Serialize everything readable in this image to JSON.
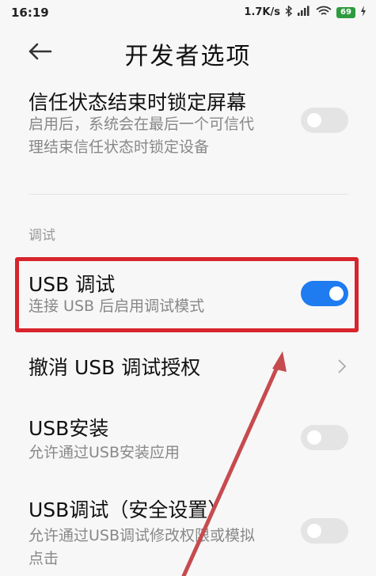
{
  "status_bar": {
    "time": "16:19",
    "speed": "1.7K/s",
    "battery": "69"
  },
  "header": {
    "title": "开发者选项"
  },
  "settings": {
    "trust_lock": {
      "title": "信任状态结束时锁定屏幕",
      "desc_line1": "启用后，系统会在最后一个可信代",
      "desc_line2": "理结束信任状态时锁定设备",
      "enabled": false
    },
    "section_label": "调试",
    "usb_debug": {
      "title": "USB 调试",
      "desc": "连接 USB 后启用调试模式",
      "enabled": true
    },
    "revoke_usb": {
      "title": "撤消 USB 调试授权"
    },
    "usb_install": {
      "title": "USB安装",
      "desc": "允许通过USB安装应用",
      "enabled": false
    },
    "usb_debug_secure": {
      "title": "USB调试（安全设置）",
      "desc_line1": "允许通过USB调试修改权限或模拟",
      "desc_line2": "点击",
      "enabled": false
    }
  },
  "colors": {
    "toggle_on": "#1e7bf0",
    "toggle_off": "#e4e4e4",
    "highlight": "#d8242c",
    "annotation_arrow": "#c64b4f"
  }
}
